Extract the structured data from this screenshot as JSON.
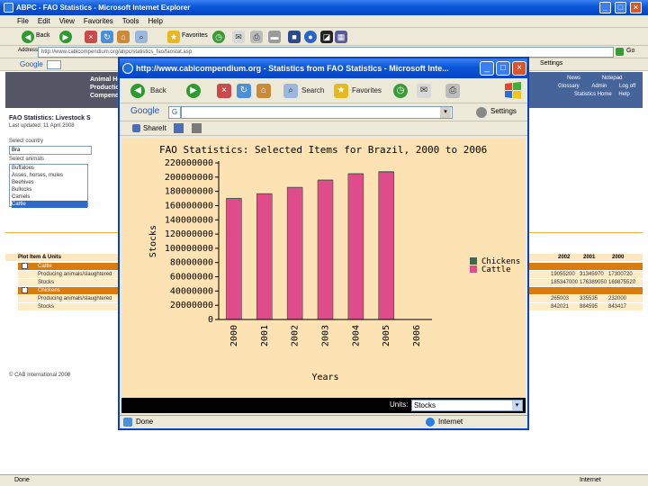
{
  "outer": {
    "title": "ABPC - FAO Statistics - Microsoft Internet Explorer",
    "menu": [
      "File",
      "Edit",
      "View",
      "Favorites",
      "Tools",
      "Help"
    ],
    "toolbar": {
      "back": "Back",
      "favorites": "Favorites"
    },
    "address_label": "Address",
    "address": "http://www.cabicompendium.org/ahpc/statistics_fao/faostat.asp",
    "google_label": "Google",
    "google_settings": "Settings",
    "go_label": "Go",
    "status": "Done",
    "zone": "Internet"
  },
  "background_page": {
    "banner_lines": [
      "Animal Hea",
      "Production",
      "Compendiu"
    ],
    "banner_links": [
      "News",
      "Notepad",
      "Glossary",
      "Admin",
      "Log off",
      "Statistics",
      "Home",
      "Help"
    ],
    "heading": "FAO Statistics: Livestock S",
    "last_updated": "Last updated: 11 April 2008",
    "country_label": "Select country",
    "country_value": "Bra",
    "animals_label": "Select animals",
    "animals": [
      "Buffaloes",
      "Asses, horses, mules",
      "Beehives",
      "Bullocks",
      "Camels",
      "Cattle"
    ],
    "table_header": "Plot Item & Units",
    "years_header": [
      "2002",
      "2001",
      "2000"
    ],
    "rows": [
      {
        "type": "group",
        "label": "Cattle"
      },
      {
        "type": "item",
        "label": "Producing animals/slaughtered",
        "values": [
          "19055200",
          "31345970",
          "17300720"
        ]
      },
      {
        "type": "item",
        "label": "Stocks",
        "values": [
          "185347000",
          "176389050",
          "169875520"
        ]
      },
      {
        "type": "group",
        "label": "Chickens"
      },
      {
        "type": "item",
        "label": "Producing animals/slaughtered",
        "values": [
          "265003",
          "335535",
          "232000"
        ]
      },
      {
        "type": "item",
        "label": "Stocks",
        "values": [
          "842021",
          "884595",
          "843417"
        ]
      }
    ],
    "footer": "© CAB International 2008"
  },
  "popup": {
    "title": "http://www.cabicompendium.org - Statistics from FAO Statistics - Microsoft Inte...",
    "toolbar": {
      "back": "Back",
      "search": "Search",
      "favorites": "Favorites"
    },
    "google_label": "Google",
    "google_settings": "Settings",
    "shareit": "ShareIt",
    "units_label": "Units:",
    "units_value": "Stocks",
    "status": "Done",
    "zone": "Internet"
  },
  "chart_data": {
    "type": "bar",
    "title": "FAO Statistics: Selected Items for Brazil, 2000 to 2006",
    "xlabel": "Years",
    "ylabel": "Stocks",
    "categories": [
      "2000",
      "2001",
      "2002",
      "2003",
      "2004",
      "2005",
      "2006"
    ],
    "stacked": true,
    "series": [
      {
        "name": "Cattle",
        "color": "#df4c8c",
        "values": [
          169875520,
          176389050,
          185347000,
          195551576,
          204512737,
          207156696,
          0
        ]
      },
      {
        "name": "Chickens",
        "color": "#3b6b52",
        "values": [
          843417,
          884595,
          842021,
          946075,
          928000,
          1152000,
          0
        ]
      }
    ],
    "ylim": [
      0,
      220000000
    ],
    "yticks": [
      0,
      20000000,
      40000000,
      60000000,
      80000000,
      100000000,
      120000000,
      140000000,
      160000000,
      180000000,
      200000000,
      220000000
    ],
    "legend": [
      {
        "name": "Chickens",
        "color": "#3b6b52"
      },
      {
        "name": "Cattle",
        "color": "#df4c8c"
      }
    ],
    "legend_position": "right"
  }
}
